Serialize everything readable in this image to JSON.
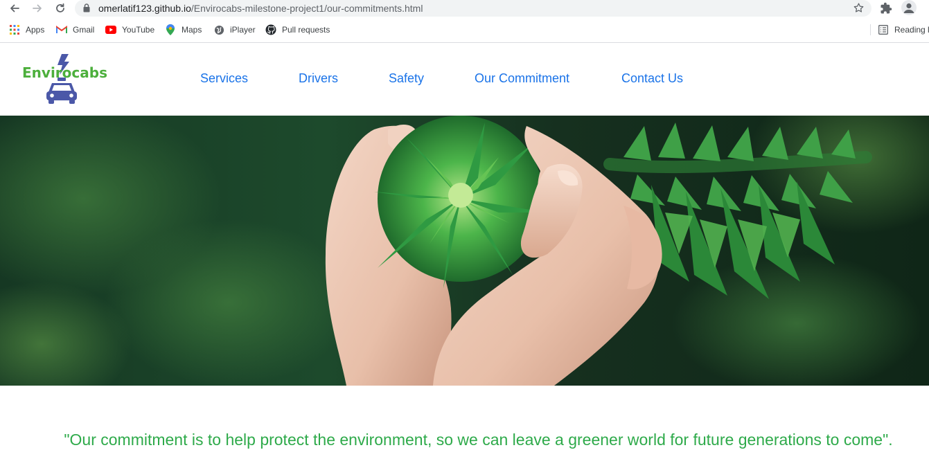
{
  "browser": {
    "url_host": "omerlatif123.github.io",
    "url_path": "/Envirocabs-milestone-project1/our-commitments.html",
    "bookmarks": [
      {
        "label": "Apps",
        "icon": "apps-grid-icon"
      },
      {
        "label": "Gmail",
        "icon": "gmail-icon"
      },
      {
        "label": "YouTube",
        "icon": "youtube-icon"
      },
      {
        "label": "Maps",
        "icon": "maps-pin-icon"
      },
      {
        "label": "iPlayer",
        "icon": "globe-icon"
      },
      {
        "label": "Pull requests",
        "icon": "github-icon"
      }
    ],
    "reading_list": "Reading li"
  },
  "site": {
    "logo_text": "Envirocabs",
    "nav": {
      "services": "Services",
      "drivers": "Drivers",
      "safety": "Safety",
      "commitment": "Our Commitment",
      "contact": "Contact Us"
    },
    "quote": "\"Our commitment is to help protect the environment, so we can leave a greener world for future generations to come\".",
    "colors": {
      "logo_green": "#4caf3c",
      "logo_blue": "#4b58a8",
      "nav_blue": "#1a73e8",
      "quote_green": "#2eaa4a"
    }
  }
}
